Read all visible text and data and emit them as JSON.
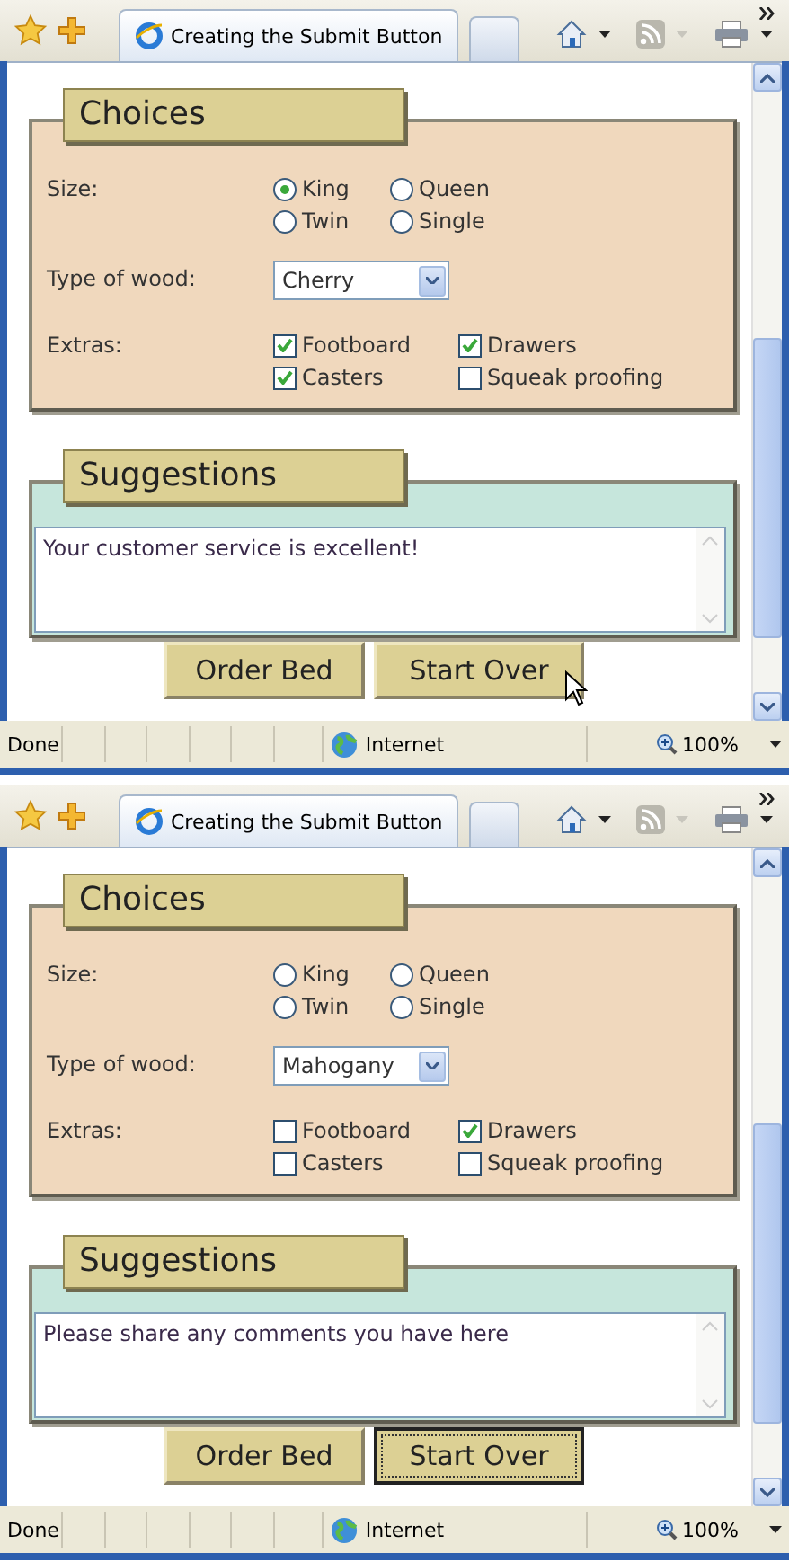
{
  "windows": [
    {
      "tab": {
        "title": "Creating the Submit Button"
      },
      "choices": {
        "title": "Choices",
        "size_label": "Size:",
        "sizes": [
          {
            "label": "King",
            "selected": true
          },
          {
            "label": "Queen",
            "selected": false
          },
          {
            "label": "Twin",
            "selected": false
          },
          {
            "label": "Single",
            "selected": false
          }
        ],
        "wood_label": "Type of wood:",
        "wood": "Cherry",
        "extras_label": "Extras:",
        "extras": [
          {
            "label": "Footboard",
            "checked": true
          },
          {
            "label": "Drawers",
            "checked": true
          },
          {
            "label": "Casters",
            "checked": true
          },
          {
            "label": "Squeak proofing",
            "checked": false
          }
        ]
      },
      "suggestions": {
        "title": "Suggestions",
        "value": "Your customer service is excellent!"
      },
      "buttons": [
        {
          "label": "Order Bed",
          "focused": false,
          "hovered": false
        },
        {
          "label": "Start Over",
          "focused": false,
          "hovered": true
        }
      ],
      "status": {
        "text": "Done",
        "zone": "Internet",
        "zoom": "100%"
      }
    },
    {
      "tab": {
        "title": "Creating the Submit Button"
      },
      "choices": {
        "title": "Choices",
        "size_label": "Size:",
        "sizes": [
          {
            "label": "King",
            "selected": false
          },
          {
            "label": "Queen",
            "selected": false
          },
          {
            "label": "Twin",
            "selected": false
          },
          {
            "label": "Single",
            "selected": false
          }
        ],
        "wood_label": "Type of wood:",
        "wood": "Mahogany",
        "extras_label": "Extras:",
        "extras": [
          {
            "label": "Footboard",
            "checked": false
          },
          {
            "label": "Drawers",
            "checked": true
          },
          {
            "label": "Casters",
            "checked": false
          },
          {
            "label": "Squeak proofing",
            "checked": false
          }
        ]
      },
      "suggestions": {
        "title": "Suggestions",
        "value": "Please share any comments you have here"
      },
      "buttons": [
        {
          "label": "Order Bed",
          "focused": false,
          "hovered": false
        },
        {
          "label": "Start Over",
          "focused": true,
          "hovered": false
        }
      ],
      "status": {
        "text": "Done",
        "zone": "Internet",
        "zoom": "100%"
      }
    }
  ]
}
